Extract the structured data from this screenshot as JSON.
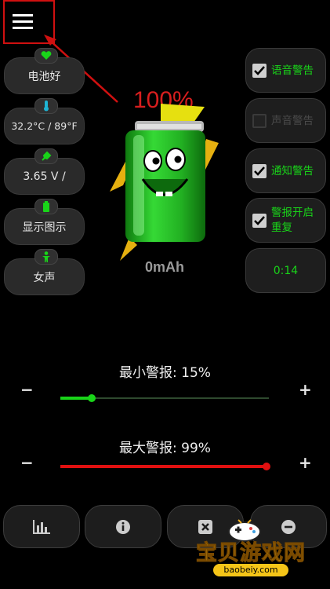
{
  "menu": {
    "icon": "menu-icon"
  },
  "status": {
    "battery_health": {
      "icon": "heart-icon",
      "label": "电池好"
    },
    "temperature": {
      "icon": "thermometer-icon",
      "label": "32.2°C / 89°F"
    },
    "voltage": {
      "icon": "plug-icon",
      "label": "3.65 V /"
    },
    "display": {
      "icon": "battery-icon",
      "label": "显示图示"
    },
    "voice": {
      "icon": "person-icon",
      "label": "女声"
    }
  },
  "battery": {
    "percent": "100%",
    "capacity": "0mAh",
    "level": 1.0
  },
  "toggles": [
    {
      "label": "语音警告",
      "checked": true
    },
    {
      "label": "声音警告",
      "checked": false
    },
    {
      "label": "通知警告",
      "checked": true
    },
    {
      "label": "警报开启重复",
      "checked": true
    }
  ],
  "timer": {
    "value": "0:14"
  },
  "min_alarm": {
    "label": "最小警报: 15%",
    "minus": "−",
    "plus": "+",
    "value": 0.15,
    "color": "#19d419"
  },
  "max_alarm": {
    "label": "最大警报: 99%",
    "minus": "−",
    "plus": "+",
    "value": 0.99,
    "color": "#e01010"
  },
  "toolbar": [
    {
      "icon": "bar-chart-icon"
    },
    {
      "icon": "info-icon"
    },
    {
      "icon": "close-box-icon"
    },
    {
      "icon": "minus-circle-icon"
    }
  ],
  "watermark": {
    "text": "宝贝游戏网",
    "url": "baobeiy.com"
  },
  "colors": {
    "accent_green": "#19d419",
    "alarm_red": "#e01010",
    "percent_red": "#d81e1e",
    "annotation_red": "#d01010"
  }
}
